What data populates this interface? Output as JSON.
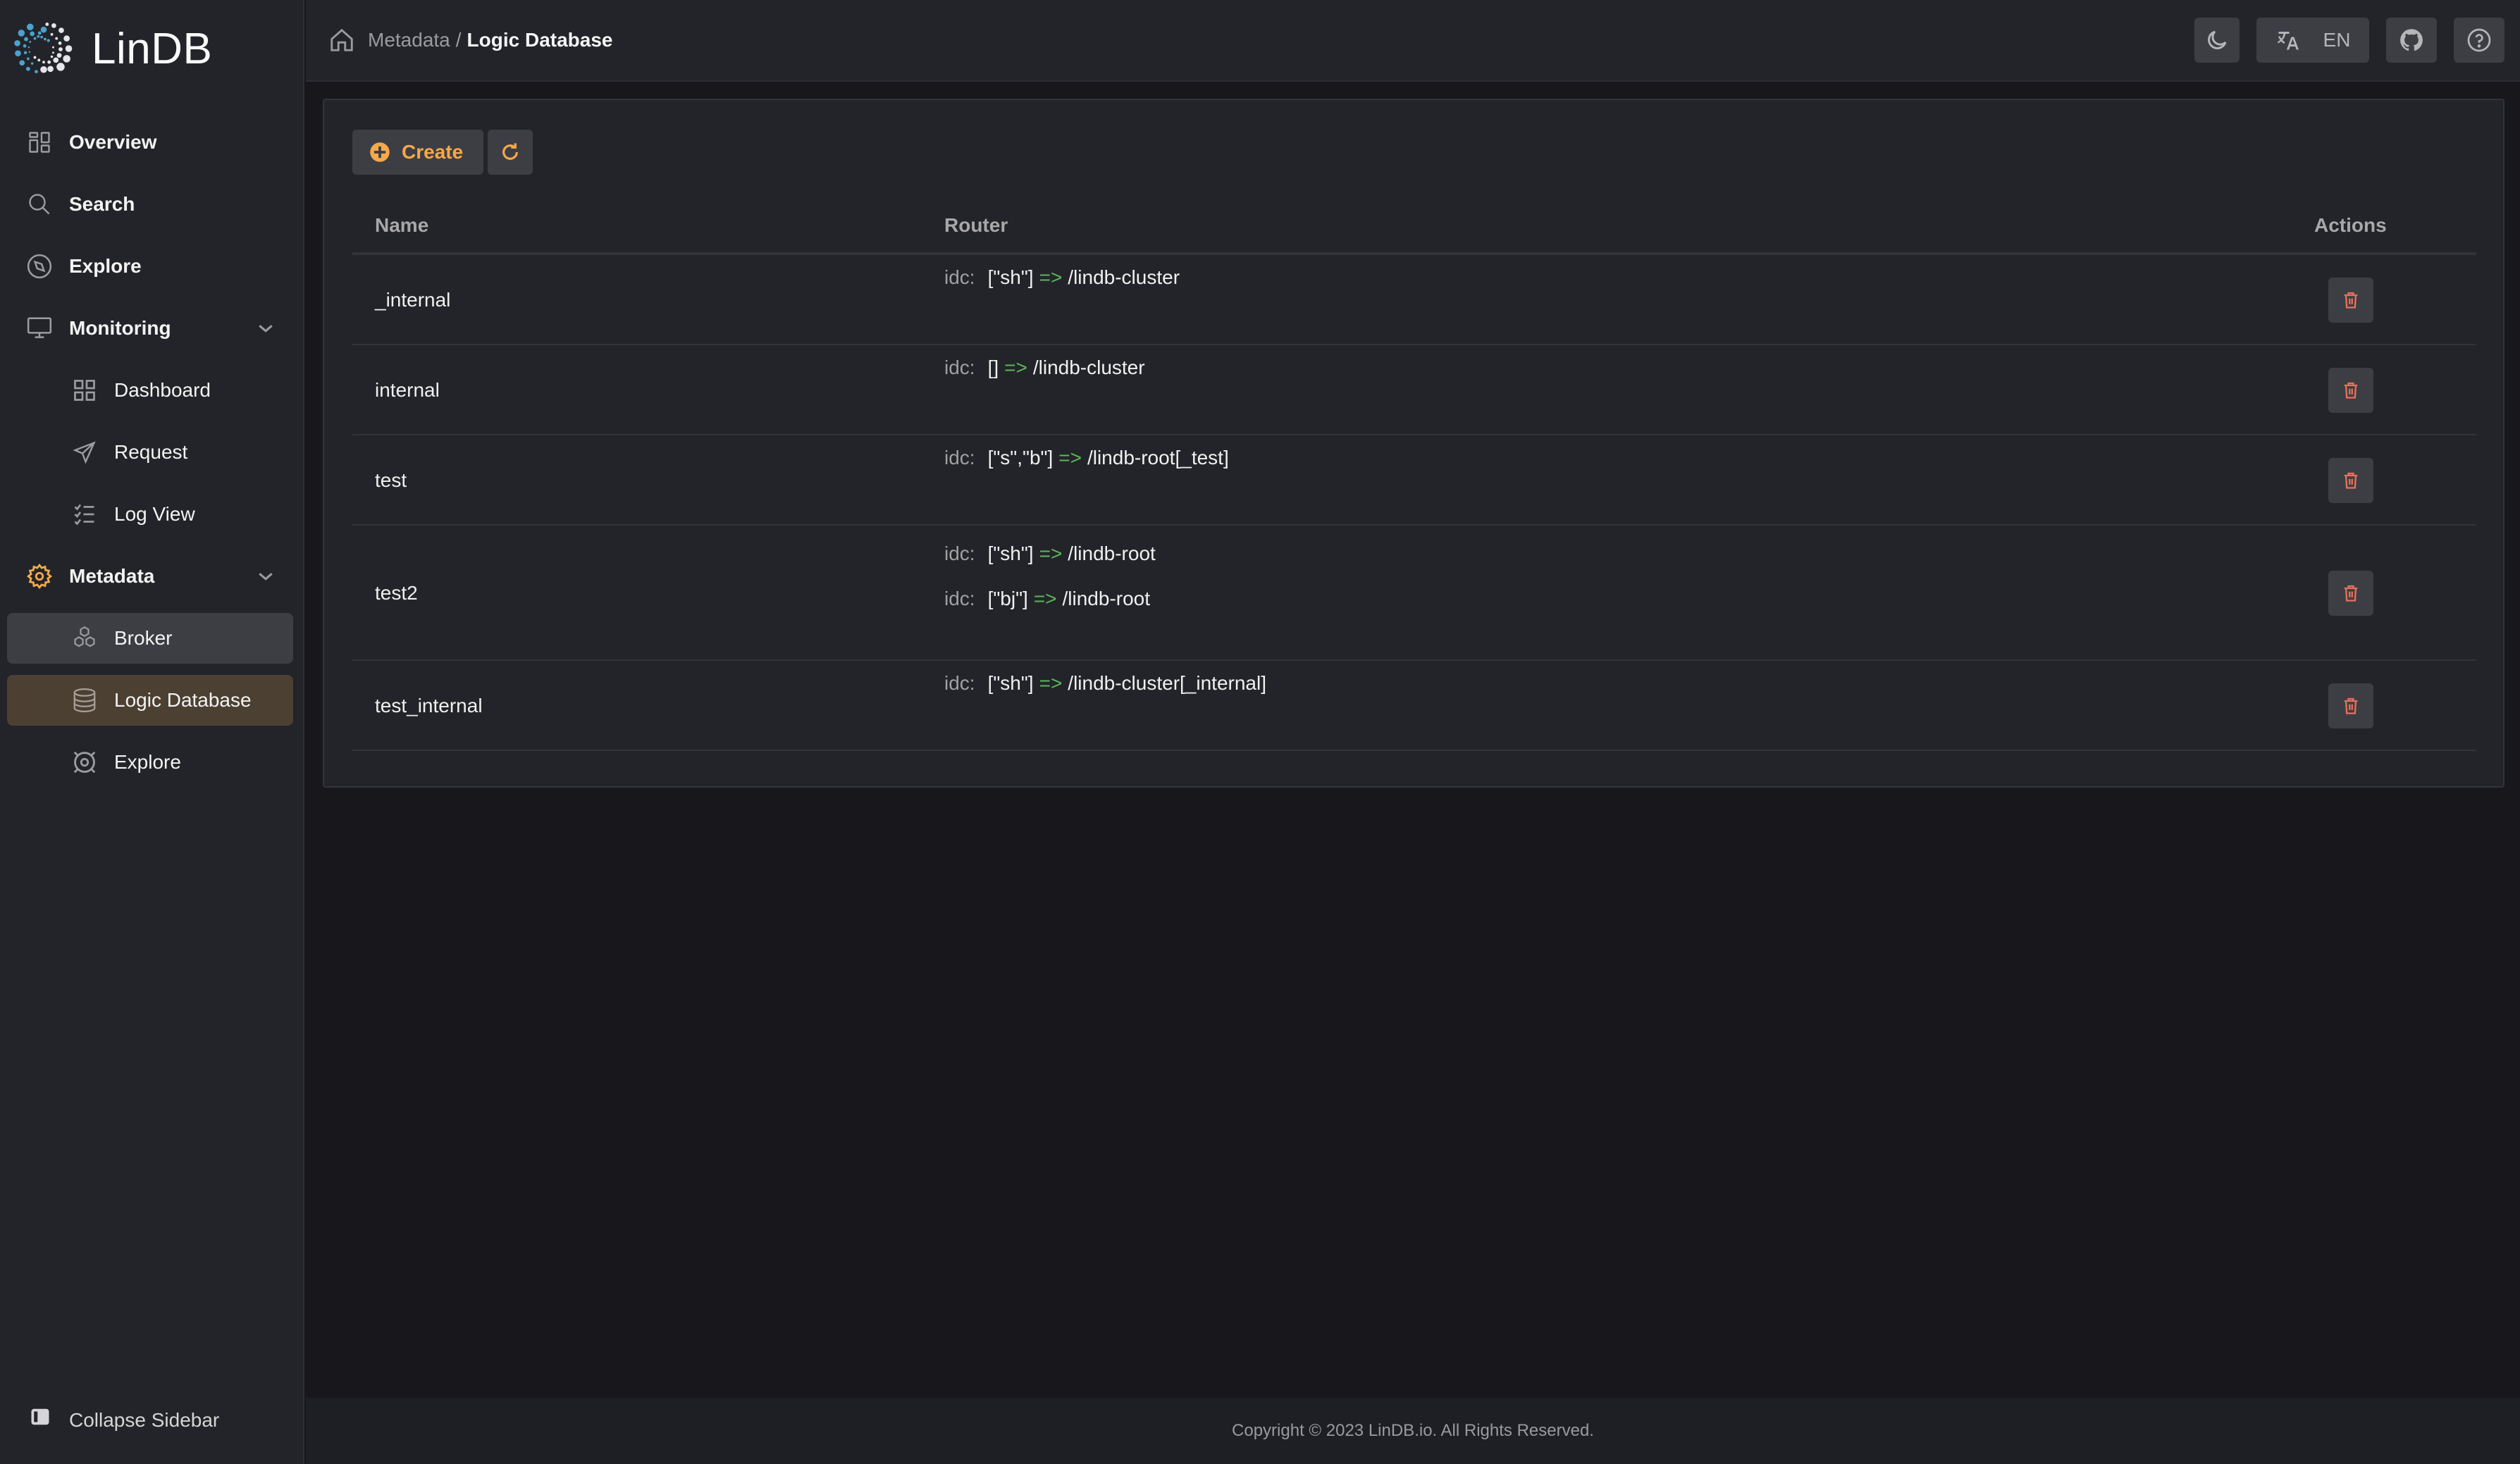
{
  "app": {
    "name": "LinDB"
  },
  "sidebar": {
    "items": [
      {
        "label": "Overview",
        "icon": "overview-icon"
      },
      {
        "label": "Search",
        "icon": "search-icon"
      },
      {
        "label": "Explore",
        "icon": "compass-icon"
      },
      {
        "label": "Monitoring",
        "icon": "monitor-icon",
        "expanded": true,
        "children": [
          {
            "label": "Dashboard",
            "icon": "dashboard-icon"
          },
          {
            "label": "Request",
            "icon": "send-icon"
          },
          {
            "label": "Log View",
            "icon": "checklist-icon"
          }
        ]
      },
      {
        "label": "Metadata",
        "icon": "gear-icon",
        "expanded": true,
        "active": true,
        "children": [
          {
            "label": "Broker",
            "icon": "hexagons-icon"
          },
          {
            "label": "Logic Database",
            "icon": "database-icon",
            "active": true
          },
          {
            "label": "Explore",
            "icon": "target-icon"
          }
        ]
      }
    ],
    "collapse_label": "Collapse Sidebar"
  },
  "header": {
    "breadcrumb": {
      "parent": "Metadata",
      "separator": "/",
      "current": "Logic Database"
    },
    "language": "EN"
  },
  "toolbar": {
    "create_label": "Create"
  },
  "table": {
    "columns": {
      "name": "Name",
      "router": "Router",
      "actions": "Actions"
    },
    "rows": [
      {
        "name": "_internal",
        "routes": [
          {
            "key": "idc:",
            "value": "[\"sh\"]",
            "arrow": "=>",
            "target": "/lindb-cluster"
          }
        ]
      },
      {
        "name": "internal",
        "routes": [
          {
            "key": "idc:",
            "value": "[]",
            "arrow": "=>",
            "target": "/lindb-cluster"
          }
        ]
      },
      {
        "name": "test",
        "routes": [
          {
            "key": "idc:",
            "value": "[\"s\",\"b\"]",
            "arrow": "=>",
            "target": "/lindb-root[_test]"
          }
        ]
      },
      {
        "name": "test2",
        "routes": [
          {
            "key": "idc:",
            "value": "[\"sh\"]",
            "arrow": "=>",
            "target": "/lindb-root"
          },
          {
            "key": "idc:",
            "value": "[\"bj\"]",
            "arrow": "=>",
            "target": "/lindb-root"
          }
        ]
      },
      {
        "name": "test_internal",
        "routes": [
          {
            "key": "idc:",
            "value": "[\"sh\"]",
            "arrow": "=>",
            "target": "/lindb-cluster[_internal]"
          }
        ]
      }
    ]
  },
  "footer": {
    "copyright": "Copyright © 2023 LinDB.io. All Rights Reserved."
  },
  "colors": {
    "accent": "#f4a94a",
    "active_bg": "#4c4032",
    "arrow": "#5cb85c",
    "danger": "#e8705a"
  }
}
